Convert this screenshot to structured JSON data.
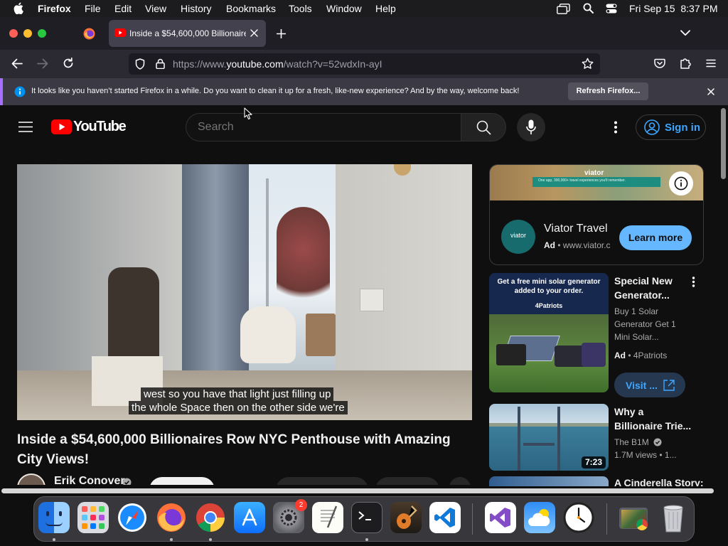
{
  "menubar": {
    "app_name": "Firefox",
    "items": [
      "File",
      "Edit",
      "View",
      "History",
      "Bookmarks",
      "Tools",
      "Window",
      "Help"
    ],
    "datetime": "Fri Sep 15  8:37 PM"
  },
  "browser": {
    "tab_title": "Inside a $54,600,000 Billionaire",
    "url_prefix": "https://www.",
    "url_domain": "youtube.com",
    "url_path": "/watch?v=52wdxIn-ayI",
    "notification_text": "It looks like you haven’t started Firefox in a while. Do you want to clean it up for a fresh, like-new experience? And by the way, welcome back!",
    "notification_button": "Refresh Firefox..."
  },
  "youtube": {
    "logo_text": "YouTube",
    "search_placeholder": "Search",
    "signin_label": "Sign in",
    "video": {
      "caption_line1": "west so you have that light just filling up",
      "caption_line2": "the whole Space then on the other side we're",
      "title": "Inside a $54,600,000 Billionaires Row NYC Penthouse with Amazing City Views!",
      "channel": "Erik Conover"
    },
    "ad": {
      "banner_brand": "viator",
      "banner_tagline": "One app, 300,000+ travel experiences you'll remember.",
      "logo_text": "viator",
      "name": "Viator Travel",
      "ad_badge": "Ad",
      "domain": "www.viator.c",
      "button": "Learn more"
    },
    "sidebar": [
      {
        "thumb_line1": "Get a free mini solar generator",
        "thumb_line2": "added to your order.",
        "thumb_brand": "4Patriots",
        "title_line1": "Special New",
        "title_line2": "Generator...",
        "desc_line1": "Buy 1 Solar",
        "desc_line2": "Generator Get 1",
        "desc_line3": "Mini Solar...",
        "ad_badge": "Ad",
        "advertiser": "4Patriots",
        "button": "Visit ..."
      },
      {
        "title_line1": "Why a",
        "title_line2": "Billionaire Trie...",
        "channel": "The B1M",
        "views": "1.7M views",
        "age": "1...",
        "duration": "7:23"
      },
      {
        "title_line1": "A Cinderella Story:"
      }
    ]
  },
  "dock": {
    "settings_badge": "2"
  },
  "colors": {
    "youtube_red": "#ff0000",
    "link_blue": "#3ea6ff",
    "learn_more_blue": "#65b8ff",
    "firefox_accent": "#a66fff",
    "info_blue": "#0090ed",
    "viator_green": "#186b6d"
  }
}
